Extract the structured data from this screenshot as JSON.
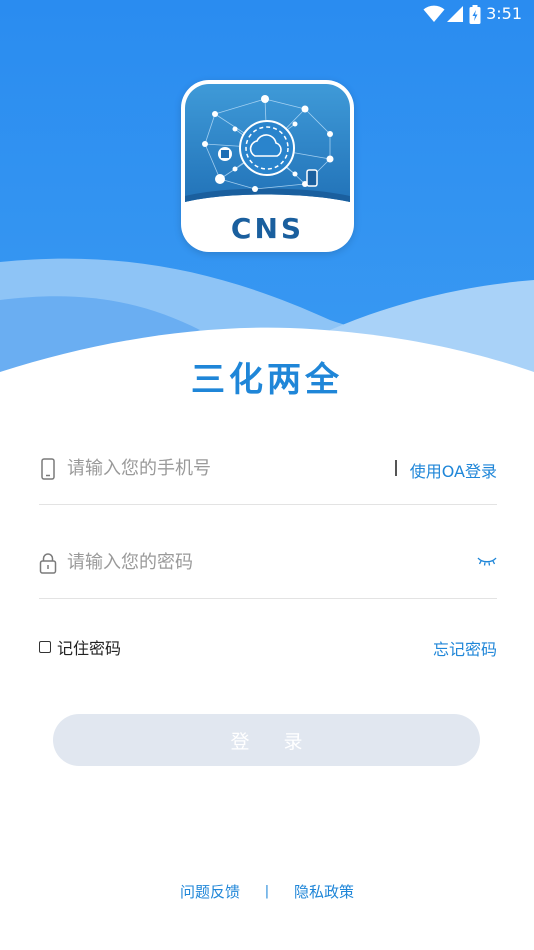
{
  "status": {
    "time": "3:51"
  },
  "logo": {
    "text": "CNS"
  },
  "app": {
    "title": "三化两全"
  },
  "phone": {
    "placeholder": "请输入您的手机号"
  },
  "oa_login": {
    "label": "使用OA登录"
  },
  "password": {
    "placeholder": "请输入您的密码"
  },
  "remember": {
    "label": "记住密码"
  },
  "forgot": {
    "label": "忘记密码"
  },
  "login_button": {
    "label": "登 录"
  },
  "footer": {
    "feedback": "问题反馈",
    "privacy": "隐私政策"
  },
  "colors": {
    "brand_blue": "#1f86d8",
    "hero_blue": "#2a8cf0",
    "button_disabled": "#e1e7f0"
  },
  "icons": {
    "wifi": "wifi-icon",
    "signal": "signal-icon",
    "battery": "battery-icon",
    "phone": "mobile-phone-icon",
    "lock": "lock-icon",
    "eye": "eye-closed-icon",
    "checkbox": "checkbox-icon"
  }
}
